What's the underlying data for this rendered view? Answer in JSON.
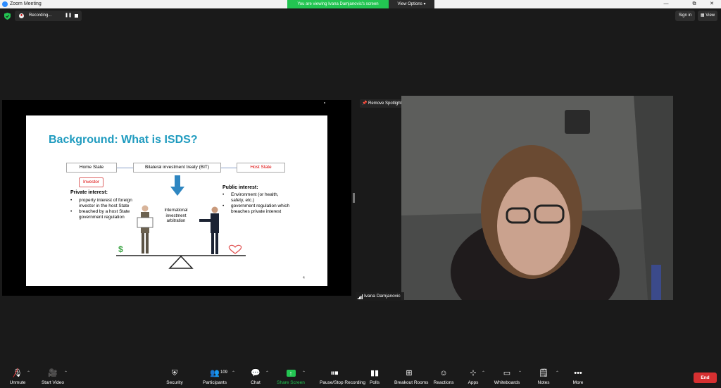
{
  "window": {
    "title": "Zoom Meeting",
    "viewing_banner": "You are viewing Ivana Damjanovic's screen",
    "view_options": "View Options",
    "minimize": "—",
    "maximize": "⧉",
    "close": "✕"
  },
  "topbar": {
    "recording_label": "Recording...",
    "pause_glyph": "❚❚",
    "sign_in": "Sign in",
    "view": "View"
  },
  "slide": {
    "title": "Background: What is ISDS?",
    "home_state": "Home State",
    "bit": "Bilateral investment treaty (BIT)",
    "host_state": "Host State",
    "investor": "Investor",
    "private_heading": "Private interest:",
    "private_bullets": [
      "property interest of foreign investor in the host State",
      "breached by a host State government regulation"
    ],
    "public_heading": "Public interest:",
    "public_bullets": [
      "Environment (or health, safety, etc.)",
      "government regulation which breaches private interest"
    ],
    "arbitration": "International investment arbitration",
    "dollar": "$",
    "page_number": "4"
  },
  "video": {
    "remove_spotlight": "Remove Spotlight",
    "speaker_name": "Ivana Damjanovic"
  },
  "toolbar": {
    "unmute": "Unmute",
    "start_video": "Start Video",
    "security": "Security",
    "participants": "Participants",
    "participants_count": "109",
    "chat": "Chat",
    "share_screen": "Share Screen",
    "recording": "Pause/Stop Recording",
    "polls": "Polls",
    "breakout_rooms": "Breakout Rooms",
    "reactions": "Reactions",
    "apps": "Apps",
    "whiteboards": "Whiteboards",
    "notes": "Notes",
    "more": "More",
    "end": "End"
  },
  "colors": {
    "accent_green": "#23c552",
    "end_red": "#d63031",
    "slide_title": "#1f9bbf"
  }
}
